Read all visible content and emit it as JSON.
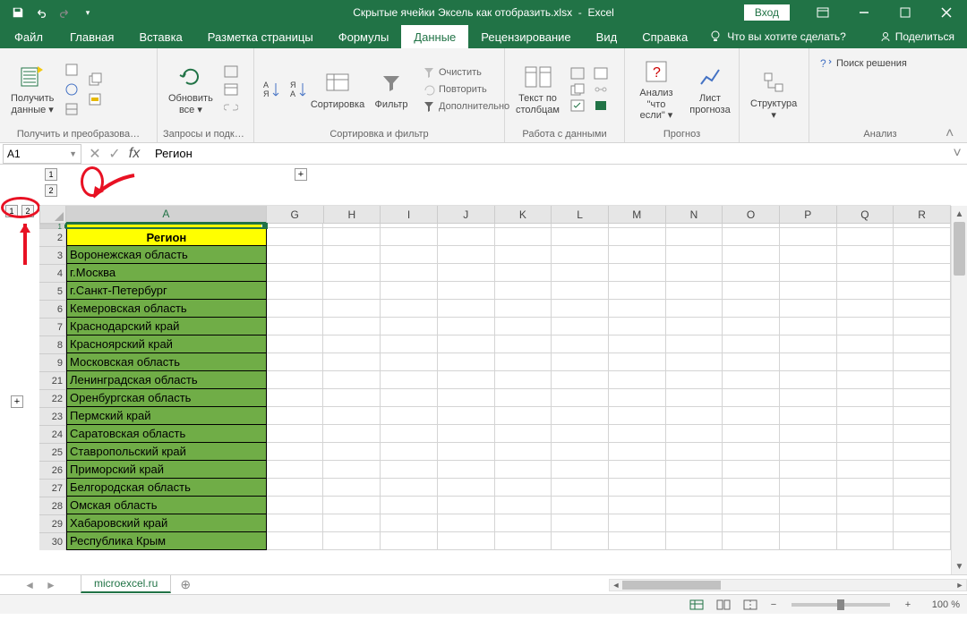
{
  "title": {
    "doc": "Скрытые ячейки Эксель как отобразить.xlsx",
    "app": "Excel",
    "signin": "Вход"
  },
  "menu": {
    "file": "Файл",
    "home": "Главная",
    "insert": "Вставка",
    "pageLayout": "Разметка страницы",
    "formulas": "Формулы",
    "data": "Данные",
    "review": "Рецензирование",
    "view": "Вид",
    "help": "Справка",
    "tellme": "Что вы хотите сделать?",
    "share": "Поделиться"
  },
  "ribbon": {
    "group1": {
      "getData": "Получить\nданные ▾",
      "label": "Получить и преобразова…"
    },
    "group2": {
      "refresh": "Обновить\nвсе ▾",
      "label": "Запросы и подключе…"
    },
    "group3": {
      "sort": "Сортировка",
      "filter": "Фильтр",
      "clear": "Очистить",
      "reapply": "Повторить",
      "advanced": "Дополнительно",
      "label": "Сортировка и фильтр"
    },
    "group4": {
      "textToCols": "Текст по\nстолбцам",
      "label": "Работа с данными"
    },
    "group5": {
      "whatIf": "Анализ \"что\nесли\" ▾",
      "forecast": "Лист\nпрогноза",
      "label": "Прогноз"
    },
    "group6": {
      "structure": "Структура\n▾",
      "label": ""
    },
    "group7": {
      "solver": "Поиск решения",
      "label": "Анализ"
    }
  },
  "namebox": "A1",
  "formula": "Регион",
  "columns": [
    "A",
    "G",
    "H",
    "I",
    "J",
    "K",
    "L",
    "M",
    "N",
    "O",
    "P",
    "Q",
    "R"
  ],
  "rows": [
    1,
    2,
    3,
    4,
    5,
    6,
    7,
    8,
    9,
    21,
    22,
    23,
    24,
    25,
    26,
    27,
    28,
    29,
    30
  ],
  "header_cell": "Регион",
  "data_cells": [
    "Воронежская область",
    "г.Москва",
    "г.Санкт-Петербург",
    "Кемеровская область",
    "Краснодарский край",
    "Красноярский край",
    "Московская область",
    "Ленинградская область",
    "Оренбургская область",
    "Пермский край",
    "Саратовская область",
    "Ставропольский край",
    "Приморский край",
    "Белгородская область",
    "Омская область",
    "Хабаровский край",
    "Республика Крым"
  ],
  "sheet_tab": "microexcel.ru",
  "status": {
    "zoom": "100 %"
  }
}
